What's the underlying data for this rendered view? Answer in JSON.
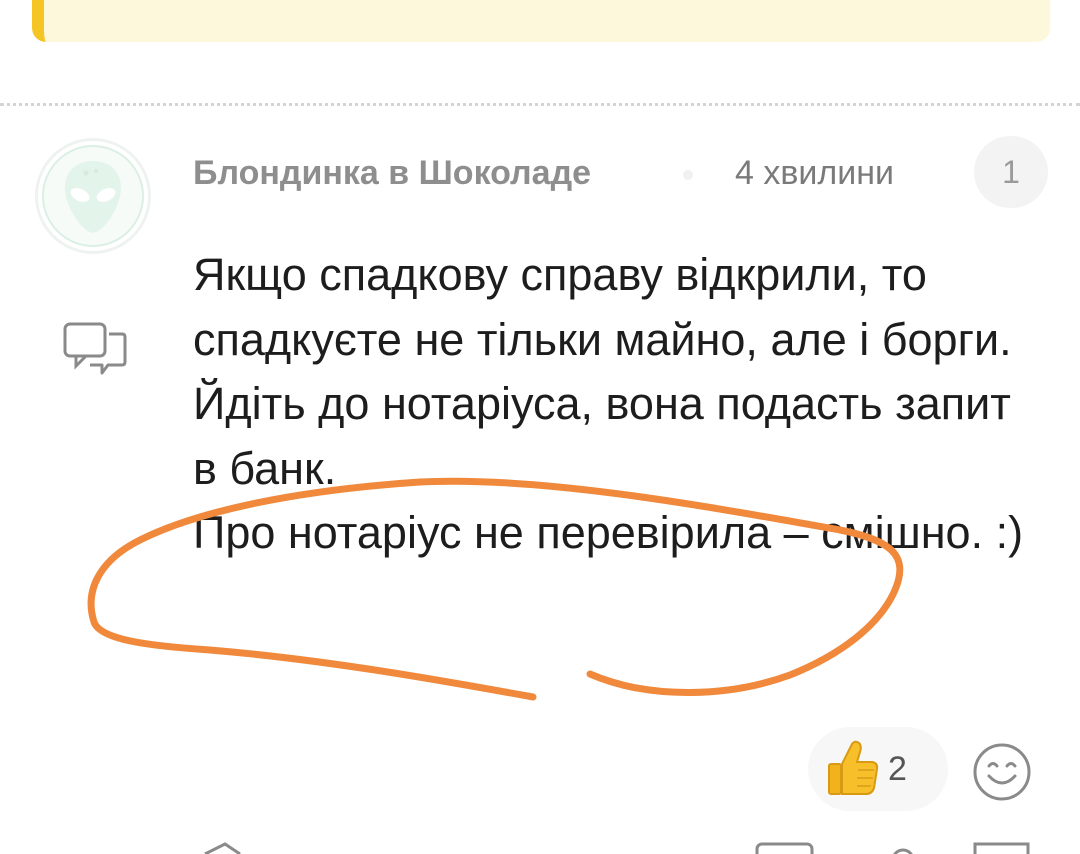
{
  "comment": {
    "author": "Блондинка в Шоколаде",
    "time": "4 хвилини",
    "badge_count": "1",
    "paragraphs": [
      "Якщо спадкову справу відкрили, то спадкуєте не тільки майно, але і борги.",
      "Йдіть до нотаріуса, вона подасть запит в банк.",
      "Про нотаріус не перевірила – смішно. :)"
    ]
  },
  "reactions": {
    "like_count": "2",
    "like_emoji": "thumbs-up-icon",
    "add_reaction_icon": "smiley-icon"
  },
  "colors": {
    "banner_bg": "#fdf8dc",
    "banner_accent": "#f5c623",
    "annotation_stroke": "#f0893c",
    "author_text": "#8e8e8e"
  }
}
